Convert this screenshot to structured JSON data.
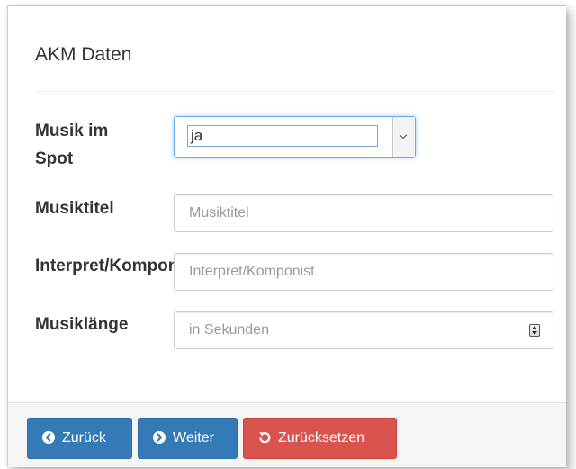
{
  "form": {
    "title": "AKM Daten",
    "fields": {
      "musik": {
        "label": "Musik im Spot",
        "value": "ja"
      },
      "titel": {
        "label": "Musiktitel",
        "placeholder": "Musiktitel"
      },
      "interpret": {
        "label": "Interpret/Komponist",
        "placeholder": "Interpret/Komponist"
      },
      "laenge": {
        "label": "Musiklänge",
        "placeholder": "in Sekunden"
      }
    }
  },
  "footer": {
    "back_label": "Zurück",
    "next_label": "Weiter",
    "reset_label": "Zurücksetzen",
    "back_icon": "circle-arrow-left-icon",
    "next_icon": "circle-arrow-right-icon",
    "reset_icon": "undo-icon"
  },
  "colors": {
    "primary": "#337ab7",
    "danger": "#d9534f",
    "focus": "#66afe9"
  }
}
